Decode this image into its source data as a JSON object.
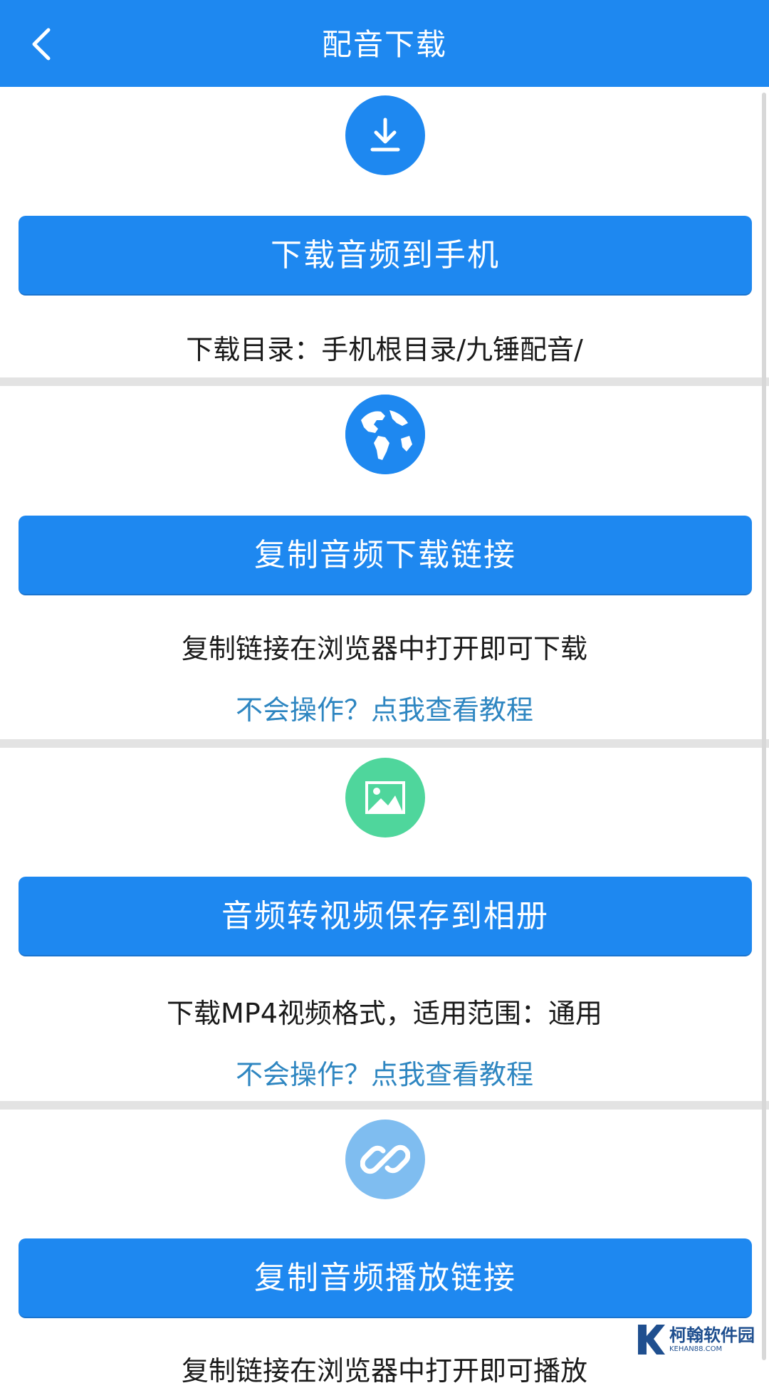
{
  "header": {
    "title": "配音下载",
    "back_icon": "chevron-left-icon"
  },
  "colors": {
    "primary": "#1e88f0",
    "link": "#2e86c1",
    "green": "#4fd69c",
    "light_blue": "#7fbdf0",
    "divider": "#e3e3e3"
  },
  "sections": [
    {
      "icon": "download-icon",
      "button_label": "下载音频到手机",
      "description": "下载目录：手机根目录/九锤配音/"
    },
    {
      "icon": "globe-icon",
      "button_label": "复制音频下载链接",
      "description": "复制链接在浏览器中打开即可下载",
      "help_link": "不会操作？点我查看教程"
    },
    {
      "icon": "image-icon",
      "button_label": "音频转视频保存到相册",
      "description": "下载MP4视频格式，适用范围：通用",
      "help_link": "不会操作？点我查看教程"
    },
    {
      "icon": "link-icon",
      "button_label": "复制音频播放链接",
      "description": "复制链接在浏览器中打开即可播放"
    }
  ],
  "watermark": {
    "name": "柯翰软件园",
    "url": "KEHAN88.COM"
  }
}
